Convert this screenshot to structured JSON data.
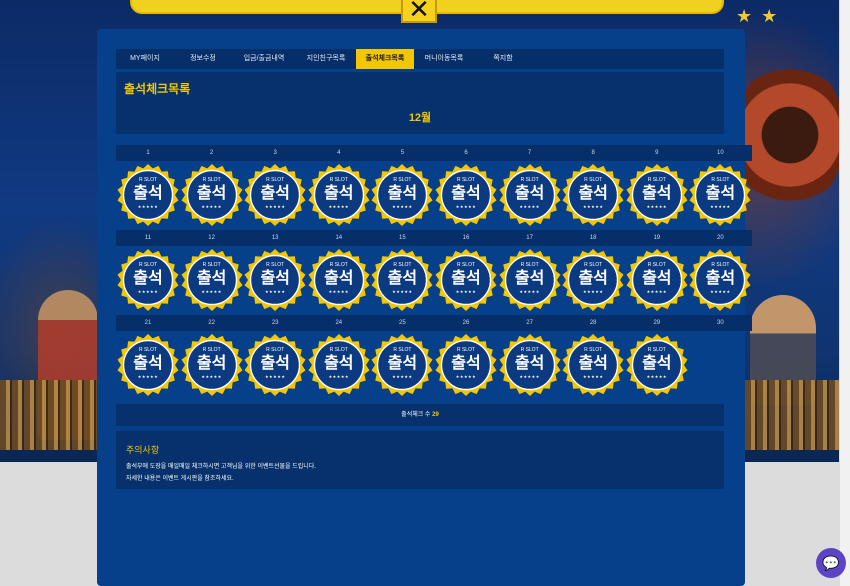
{
  "tabs": [
    {
      "label": "MY페이지",
      "active": false
    },
    {
      "label": "정보수정",
      "active": false
    },
    {
      "label": "입금/출금내역",
      "active": false
    },
    {
      "label": "지인친구목록",
      "active": false
    },
    {
      "label": "출석체크목록",
      "active": true
    },
    {
      "label": "머니이동목록",
      "active": false
    },
    {
      "label": "쪽지함",
      "active": false
    }
  ],
  "page_title": "출석체크목록",
  "month": "12월",
  "stamp": {
    "brand": "R SLOT",
    "label": "출석",
    "stars": "★★★★★"
  },
  "days": [
    {
      "num": "1",
      "checked": true
    },
    {
      "num": "2",
      "checked": true
    },
    {
      "num": "3",
      "checked": true
    },
    {
      "num": "4",
      "checked": true
    },
    {
      "num": "5",
      "checked": true
    },
    {
      "num": "6",
      "checked": true
    },
    {
      "num": "7",
      "checked": true
    },
    {
      "num": "8",
      "checked": true
    },
    {
      "num": "9",
      "checked": true
    },
    {
      "num": "10",
      "checked": true
    },
    {
      "num": "11",
      "checked": true
    },
    {
      "num": "12",
      "checked": true
    },
    {
      "num": "13",
      "checked": true
    },
    {
      "num": "14",
      "checked": true
    },
    {
      "num": "15",
      "checked": true
    },
    {
      "num": "16",
      "checked": true
    },
    {
      "num": "17",
      "checked": true
    },
    {
      "num": "18",
      "checked": true
    },
    {
      "num": "19",
      "checked": true
    },
    {
      "num": "20",
      "checked": true
    },
    {
      "num": "21",
      "checked": true
    },
    {
      "num": "22",
      "checked": true
    },
    {
      "num": "23",
      "checked": true
    },
    {
      "num": "24",
      "checked": true
    },
    {
      "num": "25",
      "checked": true
    },
    {
      "num": "26",
      "checked": true
    },
    {
      "num": "27",
      "checked": true
    },
    {
      "num": "28",
      "checked": true
    },
    {
      "num": "29",
      "checked": true
    },
    {
      "num": "30",
      "checked": false
    }
  ],
  "count": {
    "label": "출석체크 수",
    "value": "29"
  },
  "notice": {
    "title": "주의사항",
    "lines": [
      "출석부에 도장을 매일매일 체크하시면 고객님을 위한 이벤트선물을 드립니다.",
      "자세한 내용은 이벤트 게시판을 참조하세요."
    ]
  },
  "colors": {
    "accent": "#f2c600",
    "panel": "#07408a",
    "row": "#062f6a"
  },
  "icons": {
    "close": "close-icon",
    "chat": "chat-icon",
    "stamp": "attendance-stamp-icon"
  }
}
